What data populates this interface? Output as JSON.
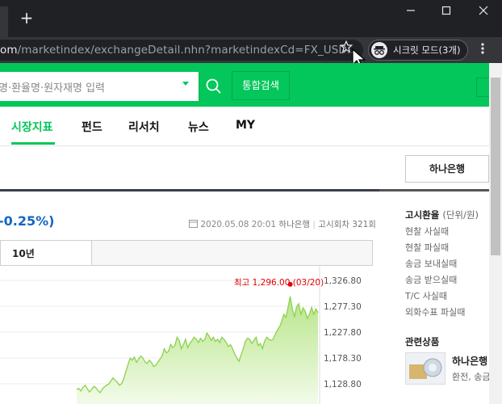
{
  "browser": {
    "new_tab": "+",
    "url_host": "om",
    "url_path": "/marketindex/exchangeDetail.nhn?marketindexCd=FX_USD...",
    "incognito_label": "시크릿 모드(3개)"
  },
  "search": {
    "placeholder": "명·환율명·원자재명 입력",
    "integrated_label": "통합검색"
  },
  "nav": {
    "items": [
      {
        "label": "시장지표"
      },
      {
        "label": "펀드"
      },
      {
        "label": "리서치"
      },
      {
        "label": "뉴스"
      },
      {
        "label": "MY"
      }
    ]
  },
  "bank_button": "하나은행",
  "quote": {
    "change": "-0.25%)",
    "datetime": "2020.05.08 20:01",
    "bank": "하나은행",
    "notice": "고시회차 321회"
  },
  "period": {
    "selected": "10년"
  },
  "chart_data": {
    "type": "area",
    "yticks": [
      "1,326.80",
      "1,277.30",
      "1,227.80",
      "1,178.30",
      "1,128.80"
    ],
    "ylim": [
      1100,
      1340
    ],
    "max_annotation": "최고 1,296.00 (03/20)",
    "max_value": 1296.0,
    "color": "#8dd14b",
    "values": [
      1118,
      1120,
      1115,
      1122,
      1126,
      1119,
      1113,
      1118,
      1124,
      1121,
      1116,
      1112,
      1119,
      1123,
      1126,
      1128,
      1134,
      1140,
      1136,
      1132,
      1126,
      1129,
      1138,
      1152,
      1165,
      1178,
      1174,
      1180,
      1170,
      1176,
      1182,
      1178,
      1171,
      1168,
      1174,
      1170,
      1162,
      1164,
      1170,
      1176,
      1182,
      1196,
      1188,
      1191,
      1204,
      1198,
      1202,
      1218,
      1212,
      1196,
      1204,
      1214,
      1198,
      1206,
      1212,
      1218,
      1214,
      1208,
      1216,
      1210,
      1214,
      1226,
      1220,
      1212,
      1218,
      1210,
      1214,
      1208,
      1218,
      1214,
      1208,
      1200,
      1204,
      1196,
      1186,
      1178,
      1172,
      1184,
      1196,
      1210,
      1216,
      1214,
      1206,
      1212,
      1218,
      1202,
      1206,
      1196,
      1210,
      1218,
      1214,
      1212,
      1214,
      1224,
      1232,
      1238,
      1248,
      1262,
      1256,
      1276,
      1296,
      1272,
      1258,
      1276,
      1282,
      1262,
      1274,
      1268,
      1254,
      1262,
      1275,
      1262,
      1272,
      1265
    ]
  },
  "sidebar": {
    "title": "고시환율",
    "unit": "(단위/원)",
    "links": [
      {
        "label": "현찰 사실때"
      },
      {
        "label": "현찰 파실때"
      },
      {
        "label": "송금 보내실때"
      },
      {
        "label": "송금 받으실때"
      },
      {
        "label": "T/C 사실때"
      },
      {
        "label": "외화수표 파실때"
      }
    ],
    "related_title": "관련상품",
    "related_name": "하나은행",
    "related_desc": "환전, 송금"
  }
}
